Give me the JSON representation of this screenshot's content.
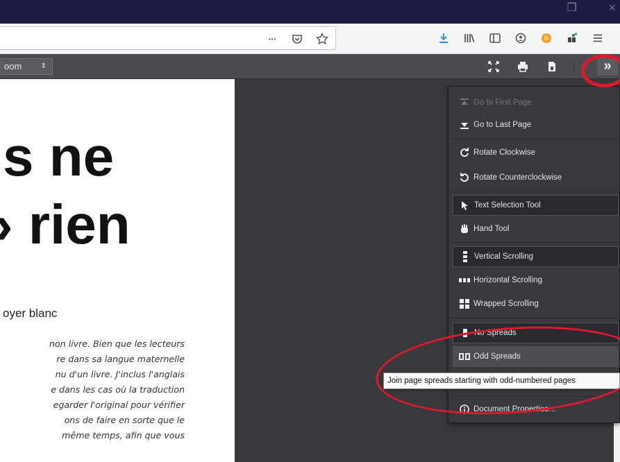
{
  "titlebar": {
    "restore_glyph": "❐",
    "close_glyph": "×"
  },
  "urlbar": {
    "actions": [
      "page-actions-icon",
      "pocket-icon",
      "bookmark-star-icon"
    ],
    "more_label": "···"
  },
  "nav_tools": [
    "downloads-icon",
    "library-icon",
    "sidebar-icon",
    "account-icon",
    "extension-icon",
    "extensions-puzzle-icon",
    "menu-icon"
  ],
  "pdf_toolbar": {
    "zoom_label": "oom",
    "zoom_arrow": "⇕",
    "buttons": [
      "presentation-mode-icon",
      "print-icon",
      "download-icon"
    ],
    "tools_toggle_label": "»"
  },
  "document": {
    "heading_line1": "s ne",
    "heading_line2": "› rien",
    "author": "oyer blanc",
    "paragraph_lines": [
      "non livre. Bien que les lecteurs",
      "re dans sa langue maternelle",
      "nu d'un livre. J'inclus l'anglais",
      "e dans les cas où la traduction",
      "egarder l'original pour vérifier",
      "ons de faire en sorte que le",
      "même temps, afin que vous"
    ]
  },
  "secondary_menu": {
    "items": [
      {
        "label": "Go to First Page",
        "icon": "first-page-icon",
        "state": "disabled"
      },
      {
        "label": "Go to Last Page",
        "icon": "last-page-icon",
        "state": "normal"
      },
      {
        "label": "Rotate Clockwise",
        "icon": "rotate-cw-icon",
        "state": "normal"
      },
      {
        "label": "Rotate Counterclockwise",
        "icon": "rotate-ccw-icon",
        "state": "normal"
      },
      {
        "label": "Text Selection Tool",
        "icon": "cursor-icon",
        "state": "active"
      },
      {
        "label": "Hand Tool",
        "icon": "hand-icon",
        "state": "normal"
      },
      {
        "label": "Vertical Scrolling",
        "icon": "vertical-scroll-icon",
        "state": "active"
      },
      {
        "label": "Horizontal Scrolling",
        "icon": "horizontal-scroll-icon",
        "state": "normal"
      },
      {
        "label": "Wrapped Scrolling",
        "icon": "wrapped-scroll-icon",
        "state": "normal"
      },
      {
        "label": "No Spreads",
        "icon": "no-spreads-icon",
        "state": "active"
      },
      {
        "label": "Odd Spreads",
        "icon": "odd-spreads-icon",
        "state": "hover"
      },
      {
        "label": "Document Properties…",
        "icon": "info-icon",
        "state": "normal"
      }
    ],
    "tooltip": "Join page spreads starting with odd-numbered pages"
  },
  "colors": {
    "annotation_red": "#e0182b",
    "menu_bg": "#39393d",
    "toolbar_bg": "#4a4a4f",
    "titlebar_bg": "#1c1b44"
  }
}
